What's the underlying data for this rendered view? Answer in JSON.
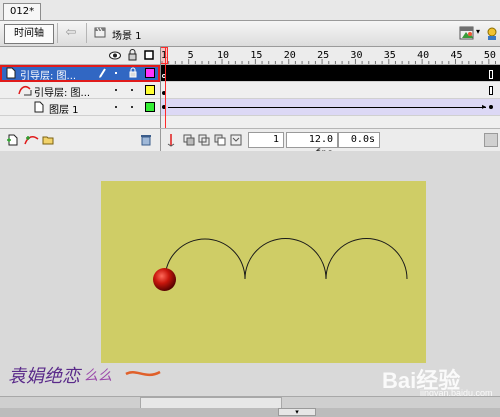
{
  "document": {
    "tab_label": "012*"
  },
  "editbar": {
    "timeline_button": "时间轴",
    "scene_label": "场景 1"
  },
  "ruler": {
    "frames": [
      "1",
      "5",
      "10",
      "15",
      "20",
      "25",
      "30",
      "35",
      "40",
      "45",
      "50"
    ]
  },
  "layers": [
    {
      "name": "引导层: 图...",
      "swatch_color": "#ff33ff",
      "selected": true
    },
    {
      "name": "引导层: 图...",
      "swatch_color": "#ffff33",
      "selected": false
    },
    {
      "name": "图层 1",
      "swatch_color": "#33ee33",
      "selected": false
    }
  ],
  "status": {
    "current_frame": "1",
    "fps": "12.0 fps",
    "time": "0.0s"
  },
  "colors": {
    "stage": "#cfcd66",
    "selection": "#3167c3",
    "playhead": "#ff2b2b"
  },
  "watermark": {
    "text": "Bai经验",
    "sub": "jingyan.baidu.com",
    "signature": "袁娟绝恋么么"
  }
}
